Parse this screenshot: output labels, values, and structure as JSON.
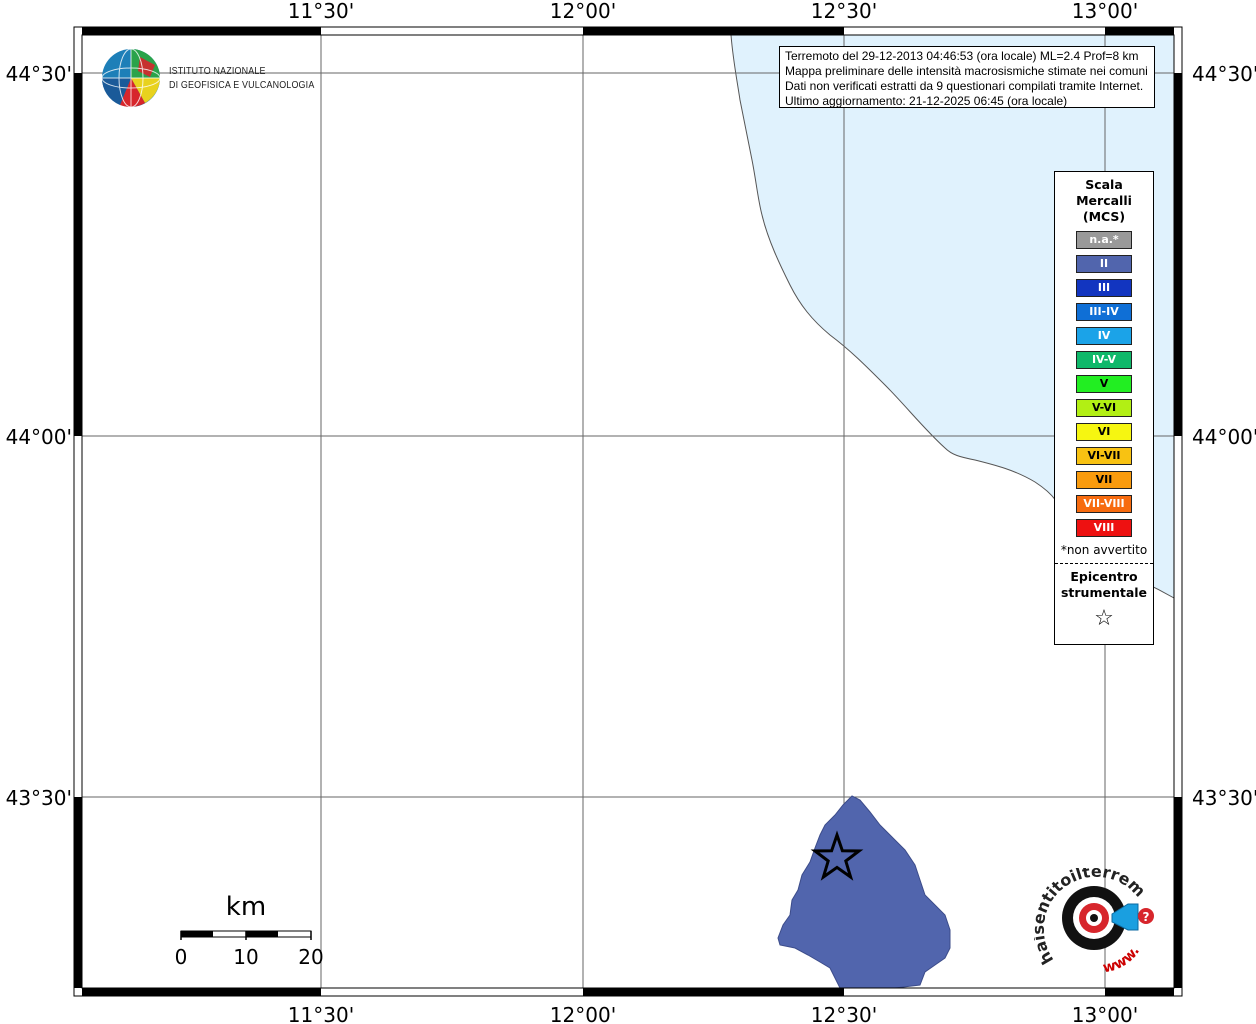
{
  "info": {
    "lines": [
      "Terremoto del 29-12-2013 04:46:53 (ora locale) ML=2.4 Prof=8 km",
      "Mappa preliminare delle intensità macrosismiche stimate nei comuni",
      "Dati non verificati estratti da 9 questionari compilati tramite Internet.",
      "Ultimo aggiornamento: 21-12-2025 06:45 (ora locale)"
    ]
  },
  "axes": {
    "lon_labels": [
      "11°30'",
      "12°00'",
      "12°30'",
      "13°00'"
    ],
    "lat_labels": [
      "44°30'",
      "44°00'",
      "43°30'"
    ]
  },
  "logo": {
    "line1": "ISTITUTO NAZIONALE",
    "line2": "DI GEOFISICA E VULCANOLOGIA"
  },
  "legend": {
    "title": "Scala\nMercalli\n(MCS)",
    "items": [
      {
        "label": "n.a.*",
        "color": "#999999"
      },
      {
        "label": "II",
        "color": "#5165ad"
      },
      {
        "label": "III",
        "color": "#1235c0"
      },
      {
        "label": "III-IV",
        "color": "#0f6fd6"
      },
      {
        "label": "IV",
        "color": "#1ba3e8"
      },
      {
        "label": "IV-V",
        "color": "#0fb86a"
      },
      {
        "label": "V",
        "color": "#22ee22"
      },
      {
        "label": "V-VI",
        "color": "#b2ef14"
      },
      {
        "label": "VI",
        "color": "#f6f611"
      },
      {
        "label": "VI-VII",
        "color": "#f8c212"
      },
      {
        "label": "VII",
        "color": "#f99b0e"
      },
      {
        "label": "VII-VIII",
        "color": "#f76b0f"
      },
      {
        "label": "VIII",
        "color": "#ee1111"
      }
    ],
    "note": "*non avvertito",
    "epicenter_title": "Epicentro\nstrumentale",
    "epicenter_symbol": "☆"
  },
  "scalebar": {
    "unit": "km",
    "labels": [
      "0",
      "10",
      "20"
    ]
  },
  "hsit": {
    "brand_text": "haisentitoilterremoto.it",
    "www_text": "www."
  },
  "colors": {
    "sea": "#e0f2fd",
    "intensity_area": "#5165ad",
    "frame": "#000000"
  }
}
